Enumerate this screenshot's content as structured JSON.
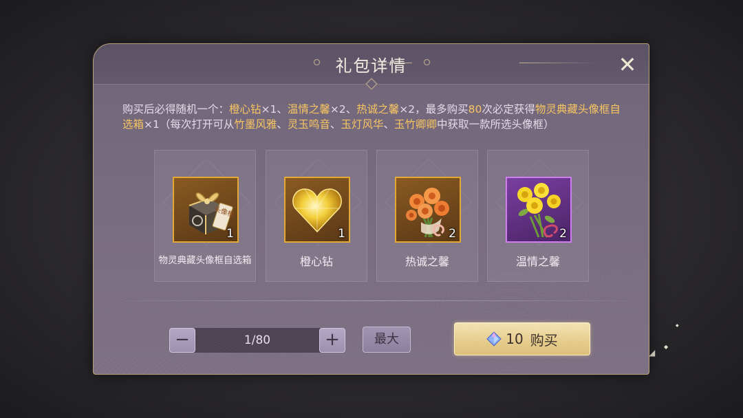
{
  "dialog": {
    "title": "礼包详情",
    "close_label": "✕",
    "description": {
      "prefix": "购买后必得随机一个：",
      "reward_1": "橙心钻",
      "reward_1_qty": "×1、",
      "reward_2": "温情之馨",
      "reward_2_qty": "×2、",
      "reward_3": "热诚之馨",
      "reward_3_qty": "×2，",
      "guarantee_prefix": "最多购买",
      "guarantee_count": "80",
      "guarantee_mid": "次必定获得",
      "guarantee_item": "物灵典藏头像框自选箱",
      "guarantee_qty": "×1（每次打开可从",
      "frame_1": "竹墨风雅",
      "sep_1": "、",
      "frame_2": "灵玉鸣音",
      "sep_2": "、",
      "frame_3": "玉灯风华",
      "sep_3": "、",
      "frame_4": "玉竹卿卿",
      "suffix": "中获取一款所选头像框）"
    },
    "items": [
      {
        "name": "物灵典藏头像框自选箱",
        "count": "1",
        "tag_text": "头像框",
        "icon": "gift-box-icon",
        "rarity_color": "#e3a934"
      },
      {
        "name": "橙心钻",
        "count": "1",
        "icon": "heart-diamond-icon",
        "rarity_color": "#e3a934"
      },
      {
        "name": "热诚之馨",
        "count": "2",
        "icon": "orange-bouquet-icon",
        "rarity_color": "#e3a934"
      },
      {
        "name": "温情之馨",
        "count": "2",
        "icon": "yellow-bouquet-icon",
        "rarity_color": "#cf7ef0"
      }
    ],
    "quantity": {
      "minus_label": "−",
      "value": "1/80",
      "plus_label": "+"
    },
    "max_label": "最大",
    "buy": {
      "currency_icon": "diamond-currency-icon",
      "price": "10",
      "label": "购买"
    }
  }
}
